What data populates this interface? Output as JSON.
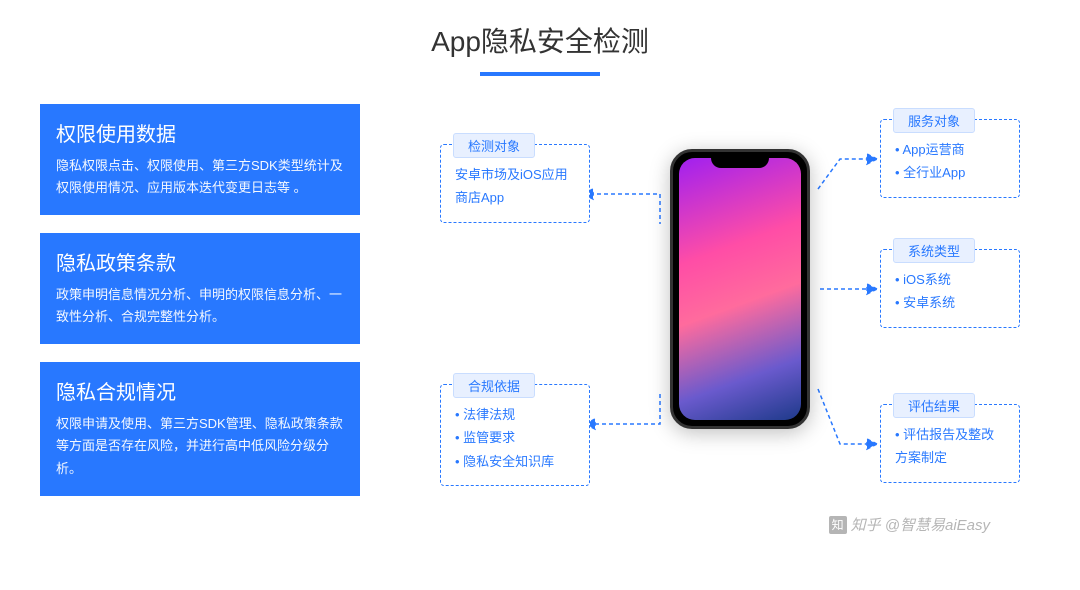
{
  "title": "App隐私安全检测",
  "leftBlocks": [
    {
      "title": "权限使用数据",
      "desc": "隐私权限点击、权限使用、第三方SDK类型统计及权限使用情况、应用版本迭代变更日志等 。"
    },
    {
      "title": "隐私政策条款",
      "desc": "政策申明信息情况分析、申明的权限信息分析、一致性分析、合规完整性分析。"
    },
    {
      "title": "隐私合规情况",
      "desc": "权限申请及使用、第三方SDK管理、隐私政策条款等方面是否存在风险，并进行高中低风险分级分析。"
    }
  ],
  "cards": {
    "detectTarget": {
      "header": "检测对象",
      "body": "安卓市场及iOS应用商店App"
    },
    "complianceBasis": {
      "header": "合规依据",
      "items": [
        "法律法规",
        "监管要求",
        "隐私安全知识库"
      ]
    },
    "serviceTarget": {
      "header": "服务对象",
      "items": [
        "App运营商",
        "全行业App"
      ]
    },
    "systemType": {
      "header": "系统类型",
      "items": [
        "iOS系统",
        "安卓系统"
      ]
    },
    "evalResult": {
      "header": "评估结果",
      "items": [
        "评估报告及整改方案制定"
      ]
    }
  },
  "watermark": "知乎 @智慧易aiEasy",
  "zhihuMark": "知"
}
